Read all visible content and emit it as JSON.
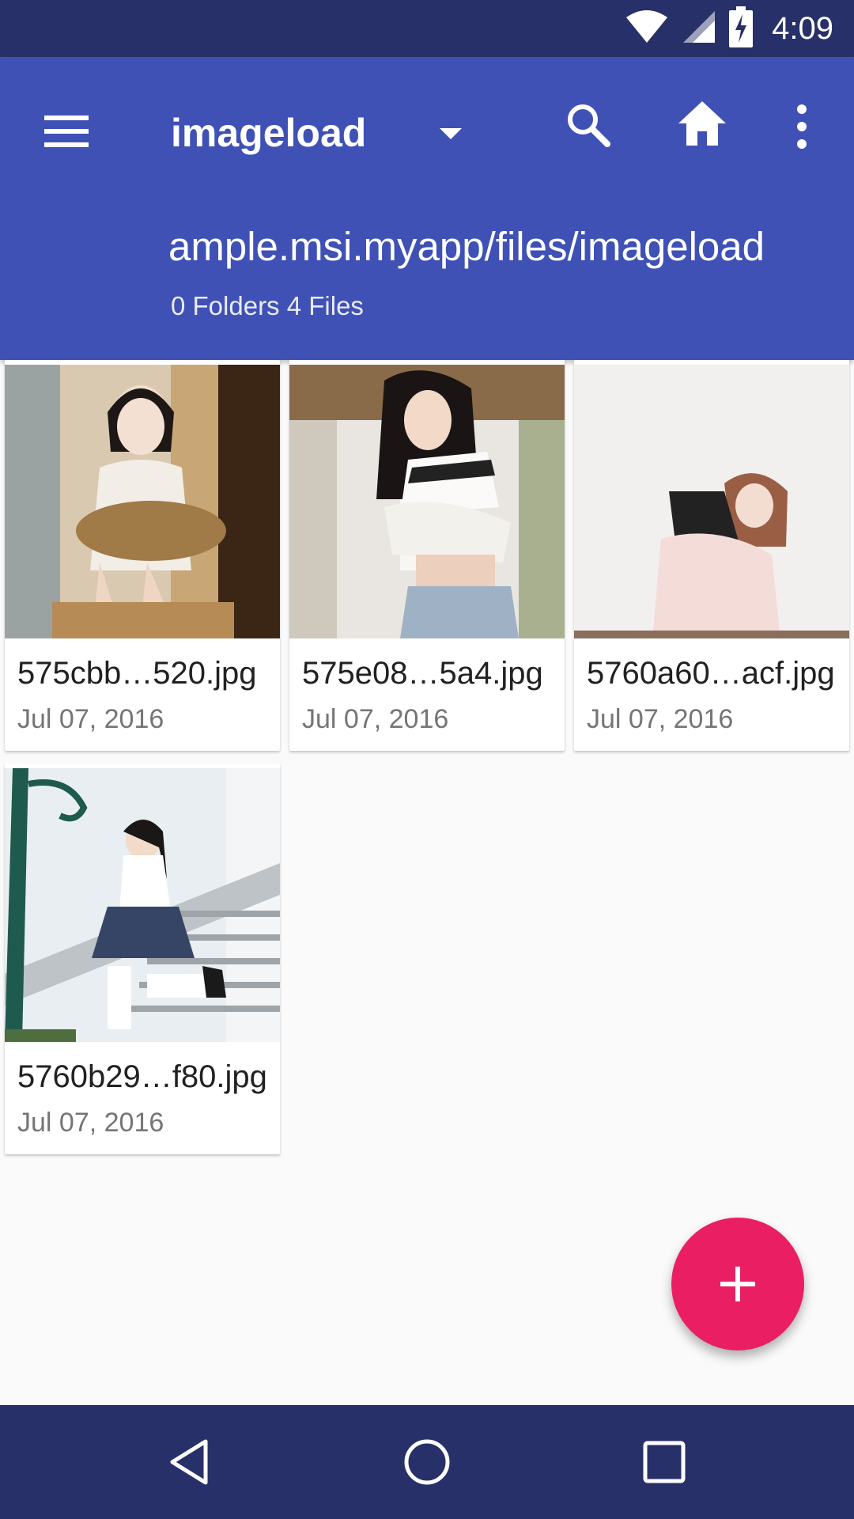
{
  "status_bar": {
    "time": "4:09",
    "icons": [
      "wifi-icon",
      "signal-icon",
      "battery-charging-icon"
    ],
    "color": "#283069"
  },
  "app_bar": {
    "title": "imageload",
    "path": "ample.msi.myapp/files/imageload",
    "counts": "0 Folders 4 Files",
    "color": "#3f51b5",
    "icons": [
      "menu-icon",
      "dropdown-icon",
      "search-icon",
      "home-icon",
      "more-vert-icon"
    ]
  },
  "files": [
    {
      "name": "575cbb…520.jpg",
      "date": "Jul 07, 2016"
    },
    {
      "name": "575e08…5a4.jpg",
      "date": "Jul 07, 2016"
    },
    {
      "name": "5760a60…acf.jpg",
      "date": "Jul 07, 2016"
    },
    {
      "name": "5760b29…f80.jpg",
      "date": "Jul 07, 2016"
    }
  ],
  "fab": {
    "icon": "add-icon",
    "color": "#e91e63"
  },
  "nav_bar": {
    "icons": [
      "back-icon",
      "home-circle-icon",
      "recents-icon"
    ]
  }
}
